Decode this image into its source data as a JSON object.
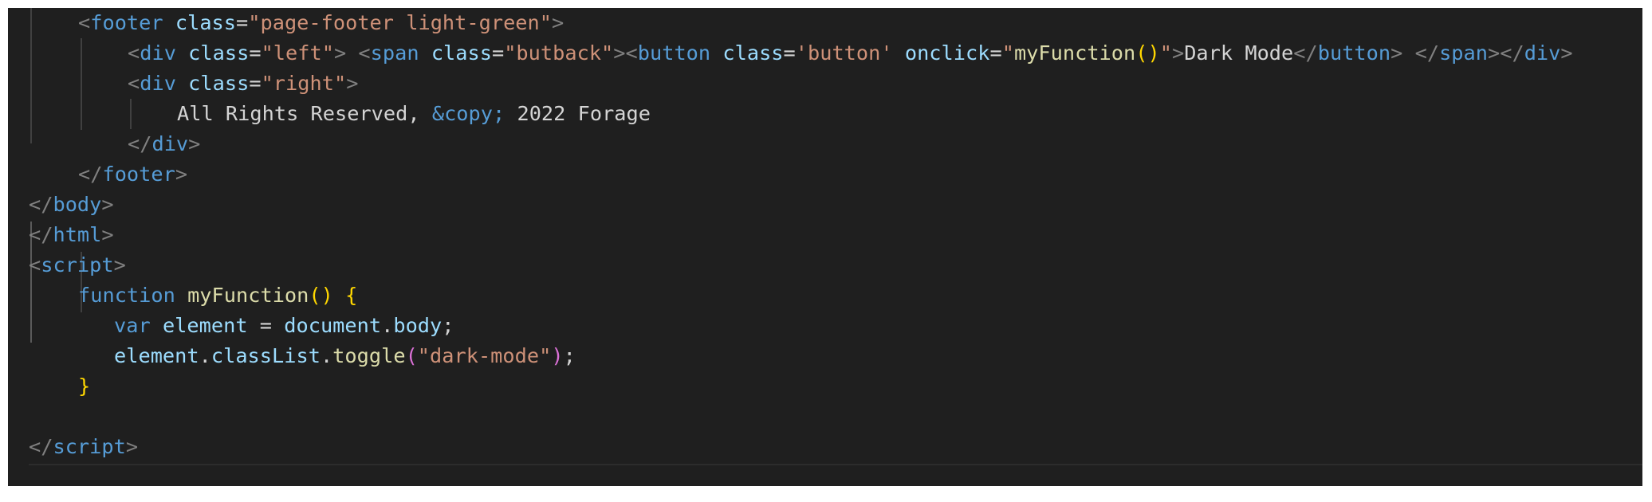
{
  "editor": {
    "colors": {
      "background": "#1f1f1f",
      "tag": "#569cd6",
      "attribute": "#9cdcfe",
      "string": "#ce9178",
      "function": "#dcdcaa",
      "bracket_outer": "#ffd700",
      "bracket_inner": "#da70d6",
      "text": "#d4d4d4",
      "punctuation": "#808080"
    },
    "lines": [
      [
        {
          "t": "<",
          "c": "punc"
        },
        {
          "t": "footer",
          "c": "tag"
        },
        {
          "t": " ",
          "c": "plain"
        },
        {
          "t": "class",
          "c": "attr"
        },
        {
          "t": "=",
          "c": "plain"
        },
        {
          "t": "\"page-footer light-green\"",
          "c": "str"
        },
        {
          "t": ">",
          "c": "punc"
        }
      ],
      [
        {
          "t": "<",
          "c": "punc"
        },
        {
          "t": "div",
          "c": "tag"
        },
        {
          "t": " ",
          "c": "plain"
        },
        {
          "t": "class",
          "c": "attr"
        },
        {
          "t": "=",
          "c": "plain"
        },
        {
          "t": "\"left\"",
          "c": "str"
        },
        {
          "t": ">",
          "c": "punc"
        },
        {
          "t": " ",
          "c": "plain"
        },
        {
          "t": "<",
          "c": "punc"
        },
        {
          "t": "span",
          "c": "tag"
        },
        {
          "t": " ",
          "c": "plain"
        },
        {
          "t": "class",
          "c": "attr"
        },
        {
          "t": "=",
          "c": "plain"
        },
        {
          "t": "\"butback\"",
          "c": "str"
        },
        {
          "t": ">",
          "c": "punc"
        },
        {
          "t": "<",
          "c": "punc"
        },
        {
          "t": "button",
          "c": "tag"
        },
        {
          "t": " ",
          "c": "plain"
        },
        {
          "t": "class",
          "c": "attr"
        },
        {
          "t": "=",
          "c": "plain"
        },
        {
          "t": "'button'",
          "c": "str"
        },
        {
          "t": " ",
          "c": "plain"
        },
        {
          "t": "onclick",
          "c": "attr"
        },
        {
          "t": "=",
          "c": "plain"
        },
        {
          "t": "\"",
          "c": "str"
        },
        {
          "t": "myFunction",
          "c": "fn"
        },
        {
          "t": "()",
          "c": "br1"
        },
        {
          "t": "\"",
          "c": "str"
        },
        {
          "t": ">",
          "c": "punc"
        },
        {
          "t": "Dark Mode",
          "c": "txt"
        },
        {
          "t": "</",
          "c": "punc"
        },
        {
          "t": "button",
          "c": "tag"
        },
        {
          "t": ">",
          "c": "punc"
        },
        {
          "t": " ",
          "c": "plain"
        },
        {
          "t": "</",
          "c": "punc"
        },
        {
          "t": "span",
          "c": "tag"
        },
        {
          "t": ">",
          "c": "punc"
        },
        {
          "t": "</",
          "c": "punc"
        },
        {
          "t": "div",
          "c": "tag"
        },
        {
          "t": ">",
          "c": "punc"
        }
      ],
      [
        {
          "t": "<",
          "c": "punc"
        },
        {
          "t": "div",
          "c": "tag"
        },
        {
          "t": " ",
          "c": "plain"
        },
        {
          "t": "class",
          "c": "attr"
        },
        {
          "t": "=",
          "c": "plain"
        },
        {
          "t": "\"right\"",
          "c": "str"
        },
        {
          "t": ">",
          "c": "punc"
        }
      ],
      [
        {
          "t": "All Rights Reserved, ",
          "c": "txt"
        },
        {
          "t": "&copy;",
          "c": "ent"
        },
        {
          "t": " 2022 Forage",
          "c": "txt"
        }
      ],
      [
        {
          "t": "</",
          "c": "punc"
        },
        {
          "t": "div",
          "c": "tag"
        },
        {
          "t": ">",
          "c": "punc"
        }
      ],
      [
        {
          "t": "</",
          "c": "punc"
        },
        {
          "t": "footer",
          "c": "tag"
        },
        {
          "t": ">",
          "c": "punc"
        }
      ],
      [
        {
          "t": "</",
          "c": "punc"
        },
        {
          "t": "body",
          "c": "tag"
        },
        {
          "t": ">",
          "c": "punc"
        }
      ],
      [
        {
          "t": "</",
          "c": "punc"
        },
        {
          "t": "html",
          "c": "tag"
        },
        {
          "t": ">",
          "c": "punc"
        }
      ],
      [
        {
          "t": "<",
          "c": "punc"
        },
        {
          "t": "script",
          "c": "tag"
        },
        {
          "t": ">",
          "c": "punc"
        }
      ],
      [
        {
          "t": "function",
          "c": "kw"
        },
        {
          "t": " ",
          "c": "plain"
        },
        {
          "t": "myFunction",
          "c": "fn"
        },
        {
          "t": "()",
          "c": "br1"
        },
        {
          "t": " ",
          "c": "plain"
        },
        {
          "t": "{",
          "c": "br1"
        }
      ],
      [
        {
          "t": "var",
          "c": "kw"
        },
        {
          "t": " ",
          "c": "plain"
        },
        {
          "t": "element",
          "c": "var"
        },
        {
          "t": " = ",
          "c": "plain"
        },
        {
          "t": "document",
          "c": "var"
        },
        {
          "t": ".",
          "c": "plain"
        },
        {
          "t": "body",
          "c": "var"
        },
        {
          "t": ";",
          "c": "plain"
        }
      ],
      [
        {
          "t": "element",
          "c": "var"
        },
        {
          "t": ".",
          "c": "plain"
        },
        {
          "t": "classList",
          "c": "var"
        },
        {
          "t": ".",
          "c": "plain"
        },
        {
          "t": "toggle",
          "c": "fn"
        },
        {
          "t": "(",
          "c": "br2"
        },
        {
          "t": "\"dark-mode\"",
          "c": "str"
        },
        {
          "t": ")",
          "c": "br2"
        },
        {
          "t": ";",
          "c": "plain"
        }
      ],
      [
        {
          "t": "}",
          "c": "br1"
        }
      ],
      [],
      [
        {
          "t": "</",
          "c": "punc"
        },
        {
          "t": "script",
          "c": "tag"
        },
        {
          "t": ">",
          "c": "punc"
        }
      ]
    ]
  }
}
